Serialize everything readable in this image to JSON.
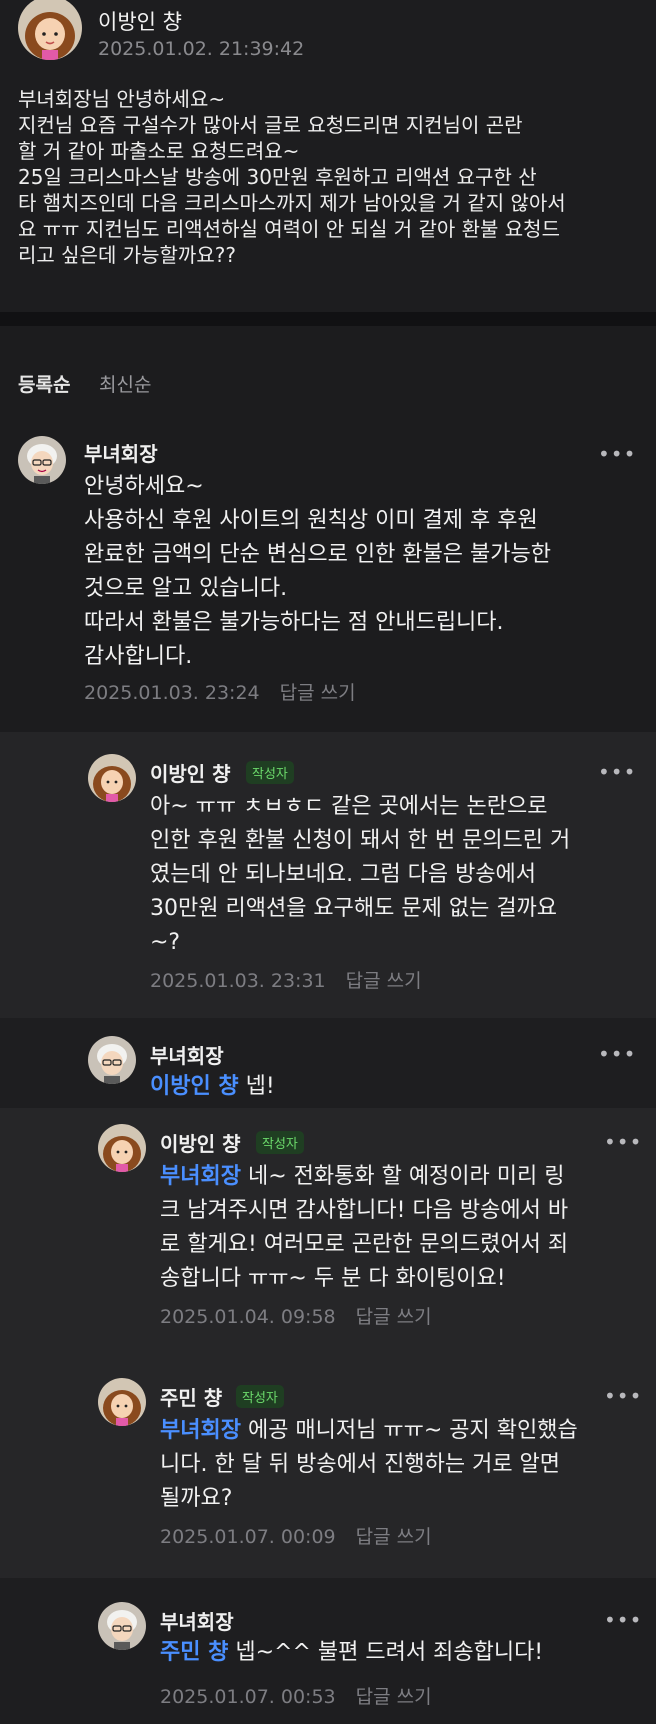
{
  "post": {
    "author": "이방인 챵",
    "date": "2025.01.02. 21:39:42",
    "lines": [
      "부녀회장님 안녕하세요~",
      "지컨님 요즘 구설수가 많아서 글로 요청드리면 지컨님이 곤란",
      "할 거 같아 파출소로 요청드려요~",
      "25일 크리스마스날 방송에 30만원 후원하고 리액션 요구한 산",
      "타 햄치즈인데 다음 크리스마스까지 제가 남아있을 거 같지 않아서",
      "요 ㅠㅠ 지컨님도 리액션하실 여력이 안 되실 거 같아 환불 요청드",
      "리고 싶은데 가능할까요??"
    ]
  },
  "sort": {
    "active": "등록순",
    "inactive": "최신순"
  },
  "more_label": "•••",
  "reply_label": "답글 쓰기",
  "author_badge": "작성자",
  "comments": [
    {
      "name": "부녀회장",
      "lines": [
        "안녕하세요~",
        "사용하신 후원 사이트의 원칙상 이미 결제 후 후원",
        "완료한 금액의 단순 변심으로 인한 환불은 불가능한",
        "것으로 알고 있습니다.",
        "따라서 환불은 불가능하다는 점 안내드립니다.",
        "감사합니다."
      ],
      "date": "2025.01.03. 23:24"
    },
    {
      "name": "이방인 챵",
      "lines": [
        "아~ ㅠㅠ ㅊㅂㅎㄷ 같은 곳에서는 논란으로",
        "인한 후원 환불 신청이 돼서 한 번 문의드린 거",
        "였는데 안 되나보네요. 그럼 다음 방송에서",
        "30만원 리액션을 요구해도 문제 없는 걸까요",
        "~?"
      ],
      "date": "2025.01.03. 23:31"
    },
    {
      "name": "부녀회장",
      "mention": "이방인 챵",
      "text": " 넵!"
    },
    {
      "name": "이방인 챵",
      "mention": "부녀회장",
      "first_line": " 네~ 전화통화 할 예정이라 미리 링",
      "lines": [
        "크 남겨주시면 감사합니다! 다음 방송에서 바",
        "로 할게요! 여러모로 곤란한 문의드렸어서 죄",
        "송합니다 ㅠㅠ~ 두 분 다 화이팅이요!"
      ],
      "date": "2025.01.04. 09:58"
    },
    {
      "name": "주민 챵",
      "mention": "부녀회장",
      "first_line": " 에공 매니저님 ㅠㅠ~ 공지 확인했습",
      "lines": [
        "니다. 한 달 뒤 방송에서 진행하는 거로 알면",
        "될까요?"
      ],
      "date": "2025.01.07. 00:09"
    },
    {
      "name": "부녀회장",
      "mention": "주민 챵",
      "text": " 넵~^^ 불편 드려서 죄송합니다!",
      "date": "2025.01.07. 00:53"
    }
  ]
}
